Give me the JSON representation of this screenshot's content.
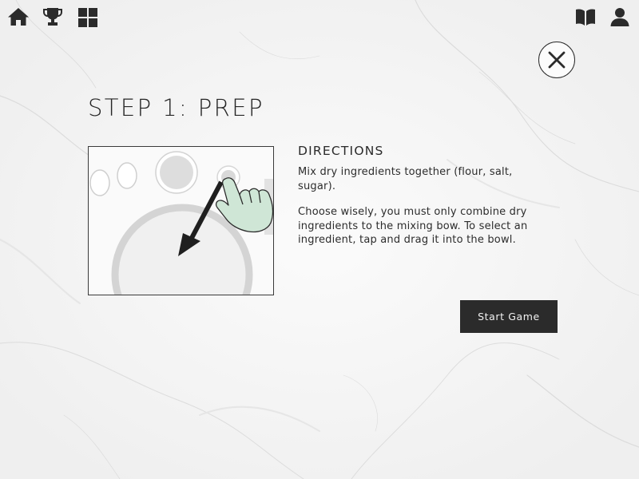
{
  "nav": {
    "left_icons": [
      "home-icon",
      "trophy-icon",
      "grid-icon"
    ],
    "right_icons": [
      "book-icon",
      "user-icon"
    ]
  },
  "close_icon": "close-icon",
  "step": {
    "title": "STEP 1: PREP"
  },
  "directions": {
    "heading": "DIRECTIONS",
    "paragraphs": [
      "Mix dry ingredients together (flour, salt, sugar).",
      "Choose wisely, you must only combine dry ingredients to the mixing bow. To select an ingredient, tap and drag it into the bowl."
    ]
  },
  "start_button": {
    "label": "Start Game"
  },
  "colors": {
    "background": "#f3f3f3",
    "icon": "#2b2b2b",
    "button_bg": "#2b2b2b",
    "button_text": "#f2f2f2",
    "hand_fill": "#cfe6d6",
    "bowl_grey": "#d6d6d6"
  }
}
